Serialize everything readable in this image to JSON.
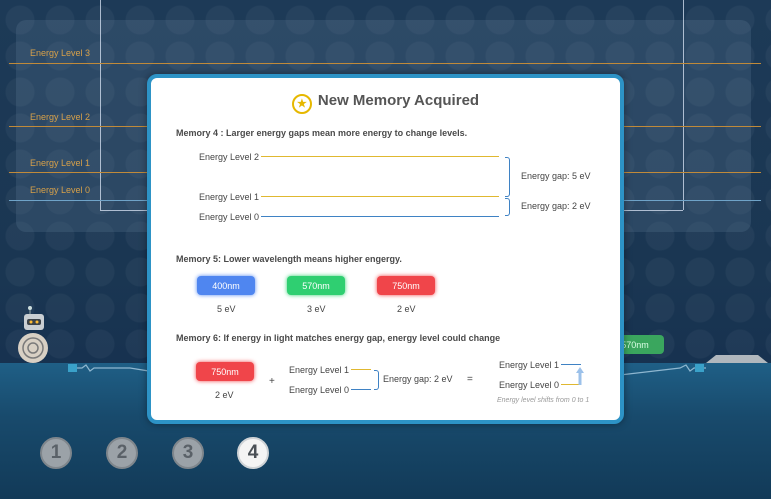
{
  "background": {
    "levels": [
      {
        "label": "Energy Level 3",
        "color": "#c08a3a"
      },
      {
        "label": "Energy Level 2",
        "color": "#c08a3a"
      },
      {
        "label": "Energy Level 1",
        "color": "#c08a3a"
      },
      {
        "label": "Energy Level 0",
        "color": "#6fa3c8"
      }
    ],
    "chip_label": "570nm"
  },
  "modal": {
    "title": "New Memory Acquired",
    "memory4": {
      "heading": "Memory 4 : Larger energy gaps mean more energy to change levels.",
      "level2": "Energy Level 2",
      "level1": "Energy Level 1",
      "level0": "Energy Level 0",
      "gap_5": "Energy gap: 5 eV",
      "gap_2": "Energy gap: 2 eV"
    },
    "memory5": {
      "heading": "Memory 5: Lower wavelength means higher engergy.",
      "chips": [
        {
          "label": "400nm",
          "energy": "5 eV",
          "color": "#4f86f0"
        },
        {
          "label": "570nm",
          "energy": "3 eV",
          "color": "#2fcf71"
        },
        {
          "label": "750nm",
          "energy": "2 eV",
          "color": "#f0454a"
        }
      ]
    },
    "memory6": {
      "heading": "Memory 6: If energy in light matches energy gap, energy level could change",
      "chip": "750nm",
      "chip_energy": "2 eV",
      "plus": "+",
      "level1": "Energy Level 1",
      "level0": "Energy Level 0",
      "gap": "Energy gap: 2 eV",
      "equals": "=",
      "result_level1": "Energy Level 1",
      "result_level0": "Energy Level 0",
      "note": "Energy level shifts from 0 to 1"
    }
  },
  "memory_buttons": [
    "1",
    "2",
    "3",
    "4"
  ],
  "active_memory": "4",
  "colors": {
    "modal_border": "#2d93c6",
    "star": "#e6b800"
  }
}
